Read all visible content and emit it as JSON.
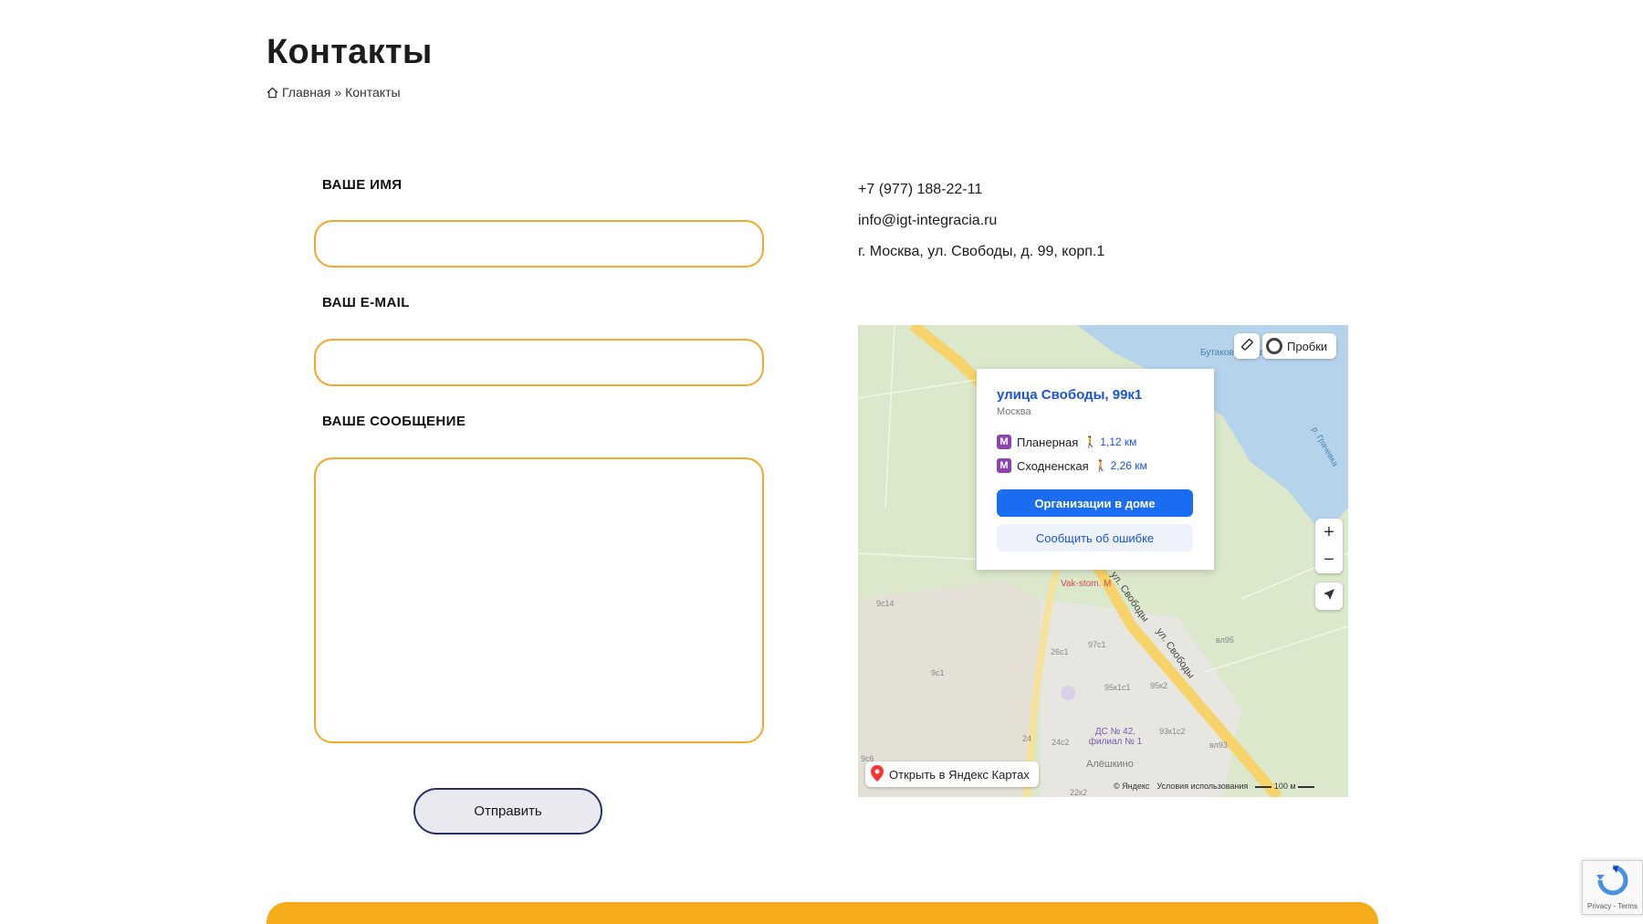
{
  "page": {
    "title": "Контакты",
    "breadcrumb": {
      "home": "Главная",
      "separator": "»",
      "current": "Контакты"
    }
  },
  "form": {
    "name_label": "ВАШЕ ИМЯ",
    "name_value": "",
    "email_label": "ВАШ E-MAIL",
    "email_value": "",
    "message_label": "ВАШЕ СООБЩЕНИЕ",
    "message_value": "",
    "submit_label": "Отправить"
  },
  "contacts": {
    "phone": "+7 (977) 188-22-11",
    "email": "info@igt-integracia.ru",
    "address": "г. Москва, ул. Свободы, д. 99, корп.1"
  },
  "map": {
    "popup": {
      "title": "улица Свободы, 99к1",
      "city": "Москва",
      "metro": [
        {
          "badge": "M",
          "name": "Планерная",
          "distance": "1,12 км"
        },
        {
          "badge": "M",
          "name": "Сходненская",
          "distance": "2,26 км"
        }
      ],
      "org_button": "Организации в доме",
      "report_button": "Сообщить об ошибке"
    },
    "traffic_label": "Пробки",
    "zoom_in": "+",
    "zoom_out": "−",
    "open_label": "Открыть в Яндекс Картах",
    "copyright": "© Яндекс",
    "terms": "Условия использования",
    "scale": "100 м",
    "labels": {
      "water": "Бутаковский залив",
      "river": "р. Грачевка",
      "street1": "ул. Свободы",
      "street2": "ул. Свободы",
      "poi": "Vak-stom. M",
      "kindergarten": "ДС № 42, филиал № 1",
      "district": "Алёшкино",
      "b1": "9с14",
      "b2": "9с1",
      "b3": "26с1",
      "b4": "97с1",
      "b5": "95к1с1",
      "b6": "95к2",
      "b7": "вл95",
      "b8": "93к1с2",
      "b9": "вл93",
      "b10": "24",
      "b11": "24с2",
      "b12": "9с6",
      "b13": "22к2"
    },
    "colors": {
      "water": "#b5d4ec",
      "park": "#d4e5c1",
      "road": "#f7d46b",
      "accent": "#1a6cf0"
    }
  },
  "recaptcha": {
    "text": "Privacy - Terms"
  },
  "colors": {
    "field_border": "#f0a92c",
    "button_border": "#25306b",
    "footer": "#f5ac1b"
  }
}
